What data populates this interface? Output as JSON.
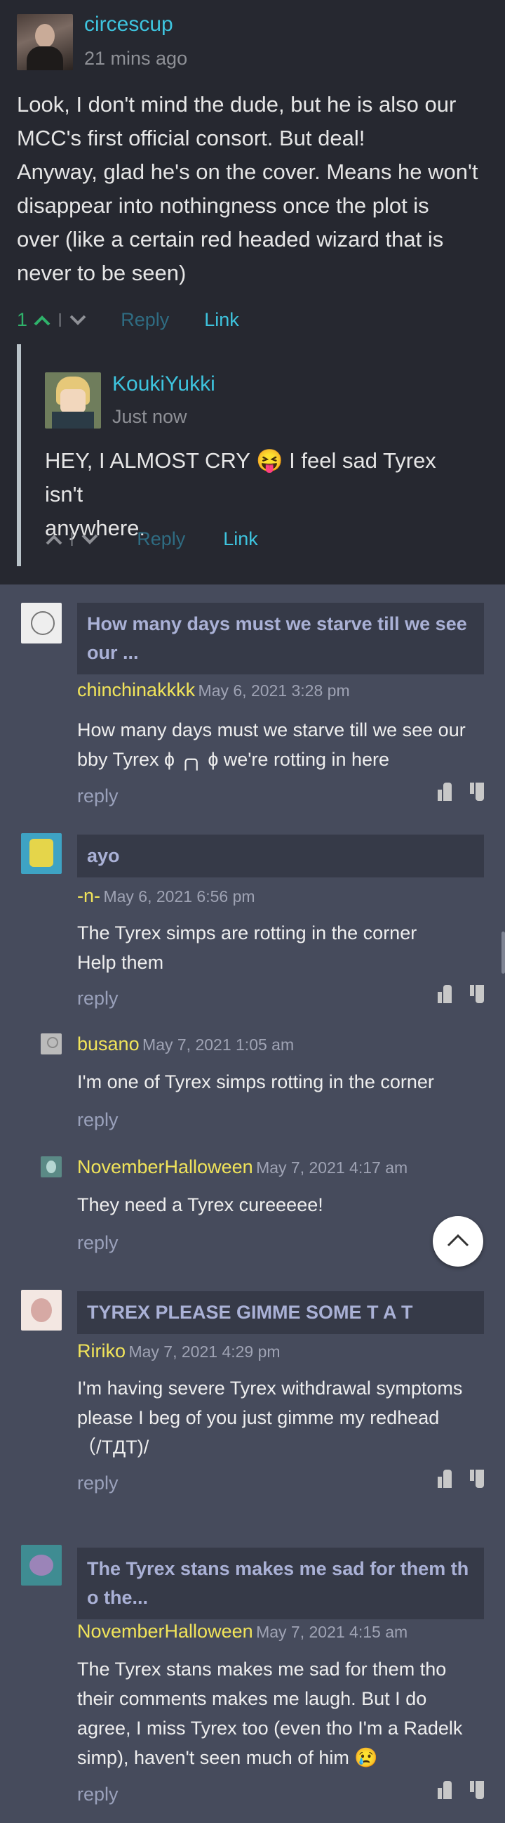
{
  "main_comment": {
    "username": "circescup",
    "time": "21 mins ago",
    "lines": [
      "Look, I don't mind the dude, but he is also our",
      "MCC's first official consort. But deal!",
      "Anyway, glad he's on the cover. Means he won't",
      "disappear into nothingness once the plot is",
      "over (like a certain red headed wizard that is",
      "never to be seen)"
    ],
    "upvotes": "1",
    "sep": "|",
    "reply_label": "Reply",
    "link_label": "Link"
  },
  "nested_comment": {
    "username": "KoukiYukki",
    "time": "Just now",
    "lines": [
      "HEY, I ALMOST CRY 😝 I feel sad Tyrex isn't",
      "anywhere."
    ],
    "sep": "|",
    "reply_label": "Reply",
    "link_label": "Link"
  },
  "comments": [
    {
      "title": [
        "How many days must we starve till we see",
        "our ..."
      ],
      "author": "chinchinakkkk",
      "date": "May 6, 2021 3:28 pm",
      "lines": [
        "How many days must we starve till we see our",
        "bby Tyrex ɸ ╭╮ ɸ we're rotting in here"
      ],
      "reply": "reply"
    },
    {
      "title": [
        "ayo"
      ],
      "author": "-n-",
      "date": "May 6, 2021 6:56 pm",
      "lines": [
        "The Tyrex simps are rotting in the corner",
        "Help them"
      ],
      "reply": "reply"
    },
    {
      "author": "busano",
      "date": "May 7, 2021 1:05 am",
      "lines": [
        "I'm one of Tyrex simps rotting in the corner"
      ],
      "reply": "reply"
    },
    {
      "author": "NovemberHalloween",
      "date": "May 7, 2021 4:17 am",
      "lines": [
        "They need a Tyrex cureeeee!"
      ],
      "reply": "reply"
    },
    {
      "title": [
        "TYREX PLEASE GIMME SOME T A T"
      ],
      "author": "Ririko",
      "date": "May 7, 2021 4:29 pm",
      "lines": [
        "I'm having severe Tyrex withdrawal symptoms",
        "please I beg of you just gimme my redhead",
        "（/TДT)/"
      ],
      "reply": "reply"
    },
    {
      "title": [
        "The Tyrex stans makes me sad for them th",
        "o the..."
      ],
      "author": "NovemberHalloween",
      "date": "May 7, 2021 4:15 am",
      "lines": [
        "The Tyrex stans makes me sad for them tho",
        "their comments makes me laugh. But I do",
        "agree, I miss Tyrex too (even tho I'm a Radelk",
        "simp), haven't seen much of him 😢"
      ],
      "reply": "reply"
    }
  ],
  "colors": {
    "accent": "#3ec4de",
    "author": "#f1e45a",
    "upvote": "#2fb36b"
  }
}
